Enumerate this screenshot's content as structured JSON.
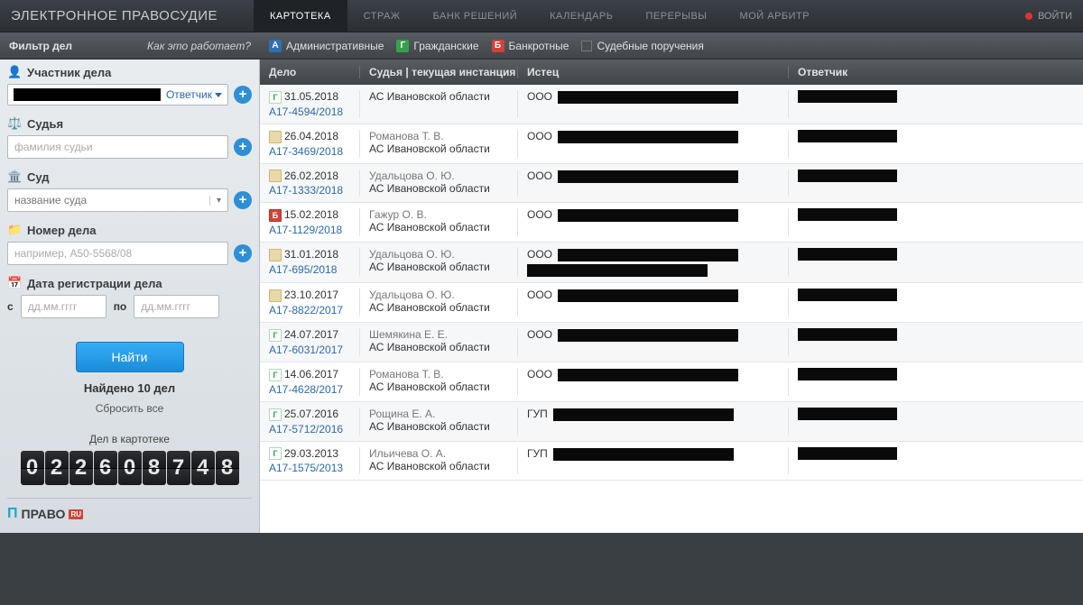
{
  "brand": "ЭЛЕКТРОННОЕ ПРАВОСУДИЕ",
  "nav": {
    "kartoteka": "КАРТОТЕКА",
    "strazh": "СТРАЖ",
    "bank": "БАНК РЕШЕНИЙ",
    "kalendar": "КАЛЕНДАРЬ",
    "pereryvy": "ПЕРЕРЫВЫ",
    "moy": "МОЙ АРБИТР",
    "login": "ВОЙТИ"
  },
  "sub": {
    "filter_title": "Фильтр дел",
    "how": "Как это работает?",
    "types": {
      "admin_badge": "А",
      "admin": "Административные",
      "civil_badge": "Г",
      "civil": "Гражданские",
      "bank_badge": "Б",
      "bank": "Банкротные",
      "orders": "Судебные поручения"
    }
  },
  "sidebar": {
    "participant_h": "Участник дела",
    "participant_role": "Ответчик",
    "judge_h": "Судья",
    "judge_ph": "фамилия судьи",
    "court_h": "Суд",
    "court_ph": "название суда",
    "caseno_h": "Номер дела",
    "caseno_ph": "например, А50-5568/08",
    "regdate_h": "Дата регистрации дела",
    "from": "с",
    "to": "по",
    "date_ph": "дд.мм.гггг",
    "search": "Найти",
    "found": "Найдено 10 дел",
    "reset": "Сбросить все",
    "counter_label": "Дел в картотеке",
    "counter_digits": [
      "0",
      "2",
      "2",
      "6",
      "0",
      "8",
      "7",
      "4",
      "8"
    ],
    "footer": "ПРАВО",
    "footer_ru": "RU"
  },
  "cols": {
    "delo": "Дело",
    "judge": "Судья | текущая инстанция",
    "istec": "Истец",
    "otv": "Ответчик"
  },
  "common_court": "АС Ивановской области",
  "rows": [
    {
      "ico": "G",
      "date": "31.05.2018",
      "num": "А17-4594/2018",
      "judge": "",
      "court": "АС Ивановской области",
      "istec_pre": "ООО"
    },
    {
      "ico": "P",
      "date": "26.04.2018",
      "num": "А17-3469/2018",
      "judge": "Романова Т. В.",
      "court": "АС Ивановской области",
      "istec_pre": "ООО"
    },
    {
      "ico": "P",
      "date": "26.02.2018",
      "num": "А17-1333/2018",
      "judge": "Удальцова О. Ю.",
      "court": "АС Ивановской области",
      "istec_pre": "ООО"
    },
    {
      "ico": "B",
      "date": "15.02.2018",
      "num": "А17-1129/2018",
      "judge": "Гажур О. В.",
      "court": "АС Ивановской области",
      "istec_pre": "ООО"
    },
    {
      "ico": "P",
      "date": "31.01.2018",
      "num": "А17-695/2018",
      "judge": "Удальцова О. Ю.",
      "court": "АС Ивановской области",
      "istec_pre": "ООО"
    },
    {
      "ico": "P",
      "date": "23.10.2017",
      "num": "А17-8822/2017",
      "judge": "Удальцова О. Ю.",
      "court": "АС Ивановской области",
      "istec_pre": "ООО"
    },
    {
      "ico": "G",
      "date": "24.07.2017",
      "num": "А17-6031/2017",
      "judge": "Шемякина Е. Е.",
      "court": "АС Ивановской области",
      "istec_pre": "ООО"
    },
    {
      "ico": "G",
      "date": "14.06.2017",
      "num": "А17-4628/2017",
      "judge": "Романова Т. В.",
      "court": "АС Ивановской области",
      "istec_pre": "ООО"
    },
    {
      "ico": "G",
      "date": "25.07.2016",
      "num": "А17-5712/2016",
      "judge": "Рощина Е. А.",
      "court": "АС Ивановской области",
      "istec_pre": "ГУП"
    },
    {
      "ico": "G",
      "date": "29.03.2013",
      "num": "А17-1575/2013",
      "judge": "Ильичева О. А.",
      "court": "АС Ивановской области",
      "istec_pre": "ГУП"
    }
  ]
}
